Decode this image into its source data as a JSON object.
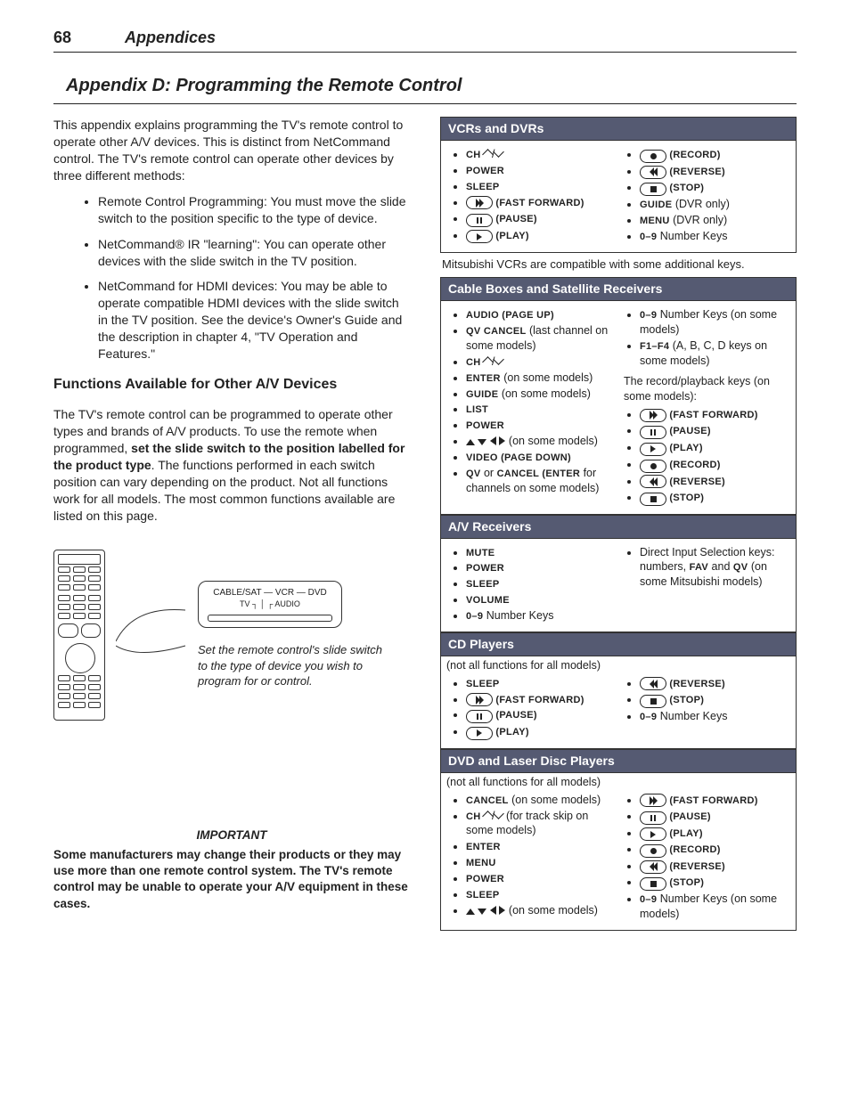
{
  "page": {
    "number": "68",
    "section": "Appendices"
  },
  "title": "Appendix D:  Programming the Remote Control",
  "intro": {
    "p1": "This appendix explains programming the TV's remote control to operate other A/V devices.  This is distinct from NetCommand control.  The TV's remote control can operate other devices by three different methods:",
    "methods": [
      "Remote Control Programming:  You must move the slide switch to the position specific to the type of device.",
      "NetCommand® IR \"learning\":  You can operate other devices with the slide switch in the TV position.",
      "NetCommand for HDMI devices:  You may be able to operate compatible HDMI devices with the slide switch in the TV position.  See the device's Owner's Guide and the description in chapter 4, \"TV Operation and Features.\""
    ]
  },
  "functions": {
    "heading": "Functions Available for Other A/V Devices",
    "body_a": "The TV's remote control can be programmed to operate other types and brands of A/V products.  To use the remote when programmed, ",
    "body_bold": "set the slide switch to the position labelled for the product type",
    "body_b": ".  The functions performed in each switch position can vary depending on the product.  Not all functions work for all models.  The most common functions available are listed on this page."
  },
  "diagram": {
    "switch_labels": "CABLE/SAT — VCR — DVD",
    "switch_sub": "TV ┐        │       ┌ AUDIO",
    "caption": "Set the remote control's slide switch to the type of device you wish to program for or control."
  },
  "important": {
    "heading": "IMPORTANT",
    "body": "Some manufacturers may change their products or they may use more than one remote control system.  The TV's remote control may be unable to operate your A/V equipment in these cases."
  },
  "tables": {
    "vcr": {
      "title": "VCRs and DVRs",
      "left": [
        {
          "key": "CH",
          "suffix_icons": "chev"
        },
        {
          "key": "POWER"
        },
        {
          "key": "SLEEP"
        },
        {
          "icon": "ff",
          "paren": "(FAST FORWARD)"
        },
        {
          "icon": "pause",
          "paren": "(PAUSE)"
        },
        {
          "icon": "play",
          "paren": "(PLAY)"
        }
      ],
      "right": [
        {
          "icon": "rec",
          "paren": "(RECORD)"
        },
        {
          "icon": "rev",
          "paren": "(REVERSE)"
        },
        {
          "icon": "stop",
          "paren": "(STOP)"
        },
        {
          "key": "GUIDE",
          "after": " (DVR only)"
        },
        {
          "key": "MENU",
          "after": " (DVR only)"
        },
        {
          "key": "0–9",
          "after": " Number Keys"
        }
      ],
      "note": "Mitsubishi VCRs are compatible with some additional keys."
    },
    "cable": {
      "title": "Cable Boxes and Satellite Receivers",
      "left": [
        {
          "key": "AUDIO (PAGE UP)"
        },
        {
          "key": "QV CANCEL",
          "after": " (last channel on some models)"
        },
        {
          "key": "CH",
          "suffix_icons": "chev"
        },
        {
          "key": "ENTER",
          "after": " (on some models)"
        },
        {
          "key": "GUIDE",
          "after": " (on some models)"
        },
        {
          "key": "LIST"
        },
        {
          "key": "POWER"
        },
        {
          "icons": "arrows",
          "after": " (on some models)"
        },
        {
          "key": "VIDEO (PAGE DOWN)"
        },
        {
          "key": "QV",
          "mid": " or ",
          "key2": "CANCEL",
          "paren": " (ENTER",
          "after": " for channels on some models)"
        }
      ],
      "right_pre": [
        {
          "key": "0–9",
          "after": " Number Keys (on some models)"
        },
        {
          "key": "F1–F4",
          "after": " (A, B, C, D keys on some models)"
        }
      ],
      "right_note": "The record/playback keys (on some models):",
      "right": [
        {
          "icon": "ff",
          "paren": "(FAST FORWARD)"
        },
        {
          "icon": "pause",
          "paren": "(PAUSE)"
        },
        {
          "icon": "play",
          "paren": "(PLAY)"
        },
        {
          "icon": "rec",
          "paren": "(RECORD)"
        },
        {
          "icon": "rev",
          "paren": "(REVERSE)"
        },
        {
          "icon": "stop",
          "paren": "(STOP)"
        }
      ]
    },
    "avr": {
      "title": "A/V Receivers",
      "left": [
        {
          "key": "MUTE"
        },
        {
          "key": "POWER"
        },
        {
          "key": "SLEEP"
        },
        {
          "key": "VOLUME"
        },
        {
          "key": "0–9",
          "after": " Number Keys"
        }
      ],
      "right_text": "Direct Input Selection keys:  numbers, FAV and QV (on some Mitsubishi models)"
    },
    "cd": {
      "title": "CD Players",
      "subnote": "(not all functions for all models)",
      "left": [
        {
          "key": "SLEEP"
        },
        {
          "icon": "ff",
          "paren": "(FAST FORWARD)"
        },
        {
          "icon": "pause",
          "paren": "(PAUSE)"
        },
        {
          "icon": "play",
          "paren": "(PLAY)"
        }
      ],
      "right": [
        {
          "icon": "rev",
          "paren": "(REVERSE)"
        },
        {
          "icon": "stop",
          "paren": "(STOP)"
        },
        {
          "key": "0–9",
          "after": " Number Keys"
        }
      ]
    },
    "dvd": {
      "title": "DVD and Laser Disc Players",
      "subnote": "(not all functions for all models)",
      "left": [
        {
          "key": "CANCEL",
          "after": " (on some models)"
        },
        {
          "key": "CH",
          "suffix_icons": "chev",
          "after": " (for track skip on some models)"
        },
        {
          "key": "ENTER"
        },
        {
          "key": "MENU"
        },
        {
          "key": "POWER"
        },
        {
          "key": "SLEEP"
        },
        {
          "icons": "arrows",
          "after": " (on some models)"
        }
      ],
      "right": [
        {
          "icon": "ff",
          "paren": "(FAST FORWARD)"
        },
        {
          "icon": "pause",
          "paren": "(PAUSE)"
        },
        {
          "icon": "play",
          "paren": "(PLAY)"
        },
        {
          "icon": "rec",
          "paren": "(RECORD)"
        },
        {
          "icon": "rev",
          "paren": "(REVERSE)"
        },
        {
          "icon": "stop",
          "paren": "(STOP)"
        },
        {
          "key": "0–9",
          "after": " Number Keys (on some models)"
        }
      ]
    }
  }
}
